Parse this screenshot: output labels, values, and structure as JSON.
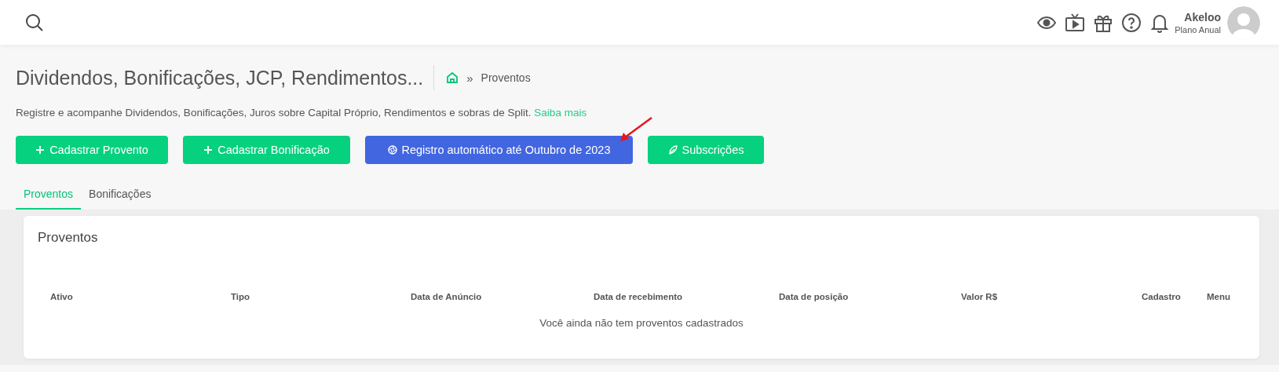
{
  "header": {
    "user": {
      "name": "Akeloo",
      "plan": "Plano Anual"
    }
  },
  "page": {
    "title": "Dividendos, Bonificações, JCP, Rendimentos...",
    "breadcrumb_separator": "»",
    "breadcrumb": "Proventos",
    "description": "Registre e acompanhe Dividendos, Bonificações, Juros sobre Capital Próprio, Rendimentos e sobras de Split.",
    "link": "Saiba mais"
  },
  "buttons": [
    {
      "label": "Cadastrar Provento",
      "kind": "green"
    },
    {
      "label": "Cadastrar Bonificação",
      "kind": "green"
    },
    {
      "label": "Registro automático até Outubro de 2023",
      "kind": "blue"
    },
    {
      "label": "Subscrições",
      "kind": "green"
    }
  ],
  "annotations": [
    {
      "kind": "arrow"
    }
  ],
  "tabs": [
    {
      "label": "Proventos",
      "selected": true
    },
    {
      "label": "Bonificações",
      "selected": false
    }
  ],
  "card": {
    "title": "Proventos",
    "columns": [
      "Ativo",
      "Tipo",
      "Data de Anúncio",
      "Data de recebimento",
      "Data de posição",
      "Valor R$",
      "Cadastro",
      "Menu"
    ],
    "empty_message": "Você ainda não tem proventos cadastrados"
  }
}
